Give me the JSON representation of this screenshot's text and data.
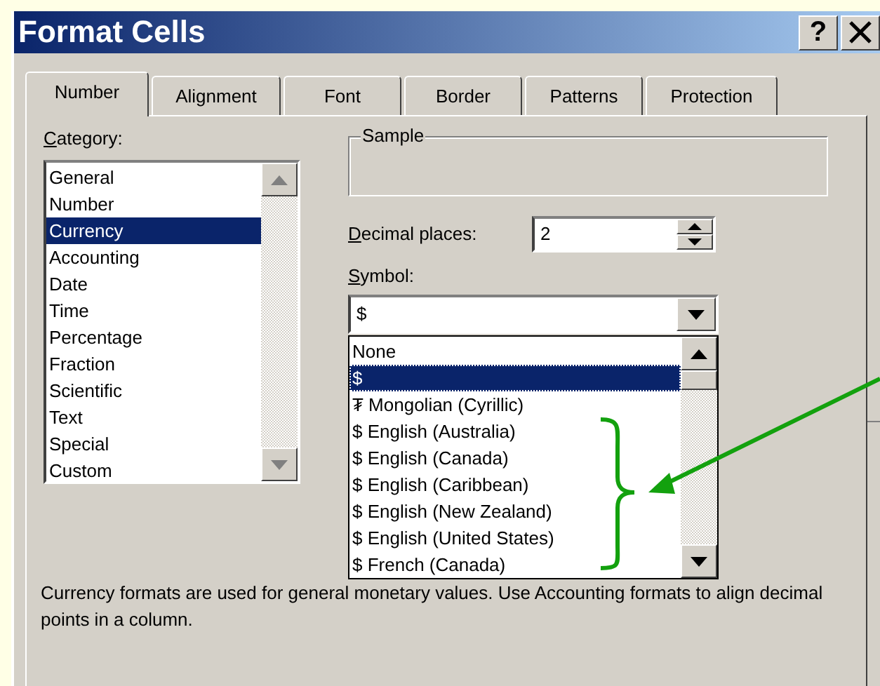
{
  "window": {
    "title": "Format Cells",
    "help_button": "?"
  },
  "tabs": [
    {
      "label": "Number",
      "selected": true
    },
    {
      "label": "Alignment",
      "selected": false
    },
    {
      "label": "Font",
      "selected": false
    },
    {
      "label": "Border",
      "selected": false
    },
    {
      "label": "Patterns",
      "selected": false
    },
    {
      "label": "Protection",
      "selected": false
    }
  ],
  "category": {
    "label": "Category:",
    "mnemonic": true,
    "items": [
      {
        "label": "General",
        "selected": false
      },
      {
        "label": "Number",
        "selected": false
      },
      {
        "label": "Currency",
        "selected": true
      },
      {
        "label": "Accounting",
        "selected": false
      },
      {
        "label": "Date",
        "selected": false
      },
      {
        "label": "Time",
        "selected": false
      },
      {
        "label": "Percentage",
        "selected": false
      },
      {
        "label": "Fraction",
        "selected": false
      },
      {
        "label": "Scientific",
        "selected": false
      },
      {
        "label": "Text",
        "selected": false
      },
      {
        "label": "Special",
        "selected": false
      },
      {
        "label": "Custom",
        "selected": false
      }
    ]
  },
  "sample": {
    "label": "Sample"
  },
  "decimal_places": {
    "label": "Decimal places:",
    "mnemonic": true,
    "value": "2"
  },
  "symbol": {
    "label": "Symbol:",
    "mnemonic": true,
    "value": "$",
    "expanded": true,
    "options": [
      {
        "label": "None",
        "selected": false
      },
      {
        "label": "$",
        "selected": true
      },
      {
        "label": "₮ Mongolian (Cyrillic)",
        "selected": false
      },
      {
        "label": "$ English (Australia)",
        "selected": false
      },
      {
        "label": "$ English (Canada)",
        "selected": false
      },
      {
        "label": "$ English (Caribbean)",
        "selected": false
      },
      {
        "label": "$ English (New Zealand)",
        "selected": false
      },
      {
        "label": "$ English (United States)",
        "selected": false
      },
      {
        "label": "$ French (Canada)",
        "selected": false
      }
    ]
  },
  "description": "Currency formats are used for general monetary values.  Use Accounting formats to align decimal points in a column."
}
